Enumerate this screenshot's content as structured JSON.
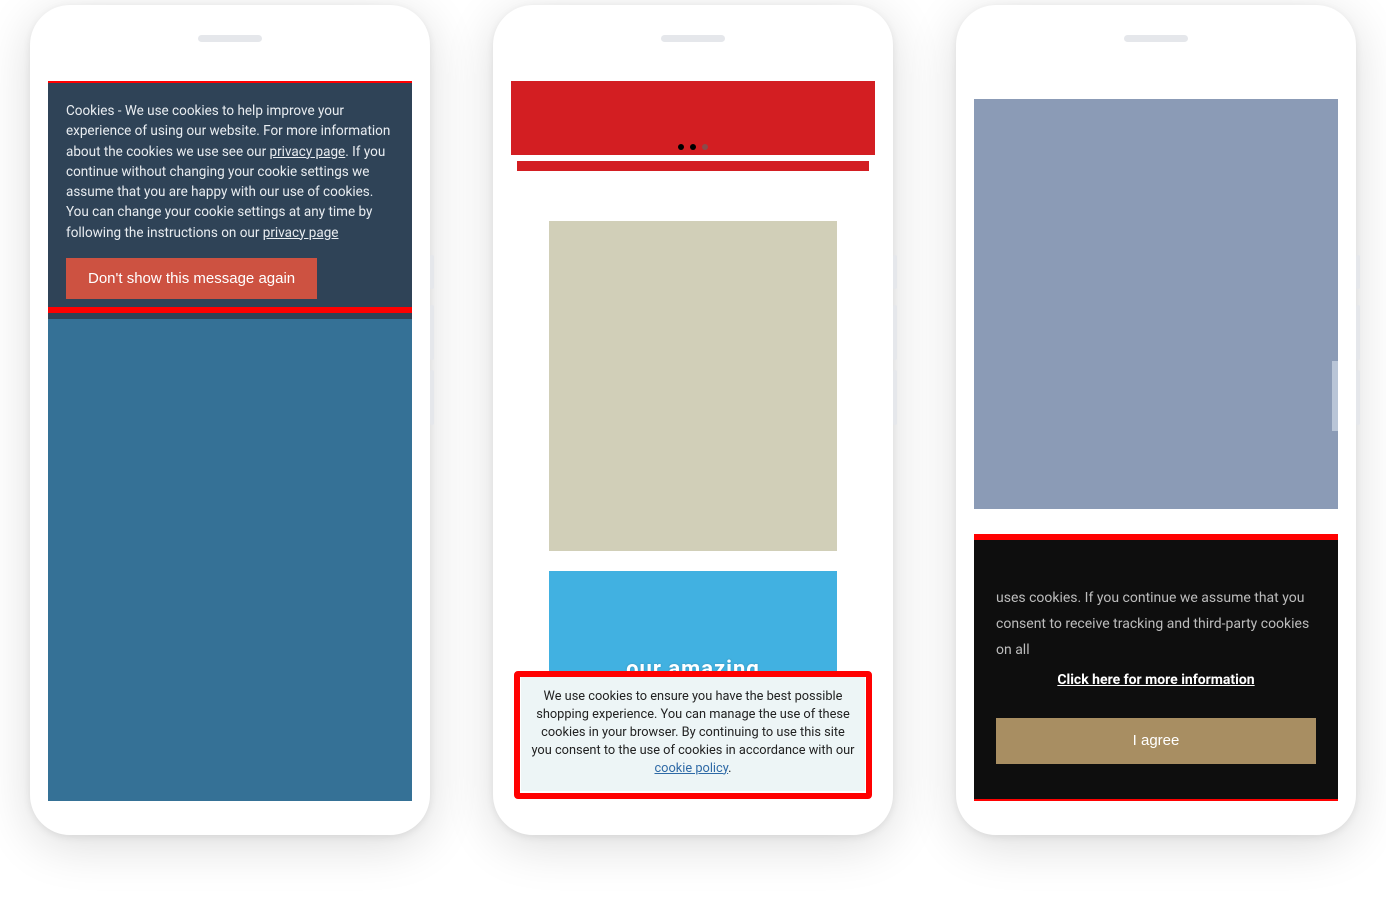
{
  "phones": [
    {
      "cookie_banner": {
        "text_before_link1": "Cookies - We use cookies to help improve your experience of using our website. For more information about the cookies we use see our ",
        "link1": "privacy page",
        "text_mid": ". If you continue without changing your cookie settings we assume that you are happy with our use of cookies. You can change your cookie settings at any time by following the instructions on our ",
        "link2": "privacy page",
        "button": "Don't show this message again"
      }
    },
    {
      "cookie_notice": {
        "text": "We use cookies to ensure you have the best possible shopping experience. You can manage the use of these cookies in your browser. By continuing to use this site you consent to the use of cookies in accordance with our ",
        "link": "cookie policy",
        "suffix": "."
      },
      "bg_text": "our amazing"
    },
    {
      "cookie_banner": {
        "text": " uses cookies. If you continue we assume that you consent to receive tracking and third-party cookies on all",
        "more_info": "Click here for more information",
        "button": "I agree"
      }
    }
  ]
}
